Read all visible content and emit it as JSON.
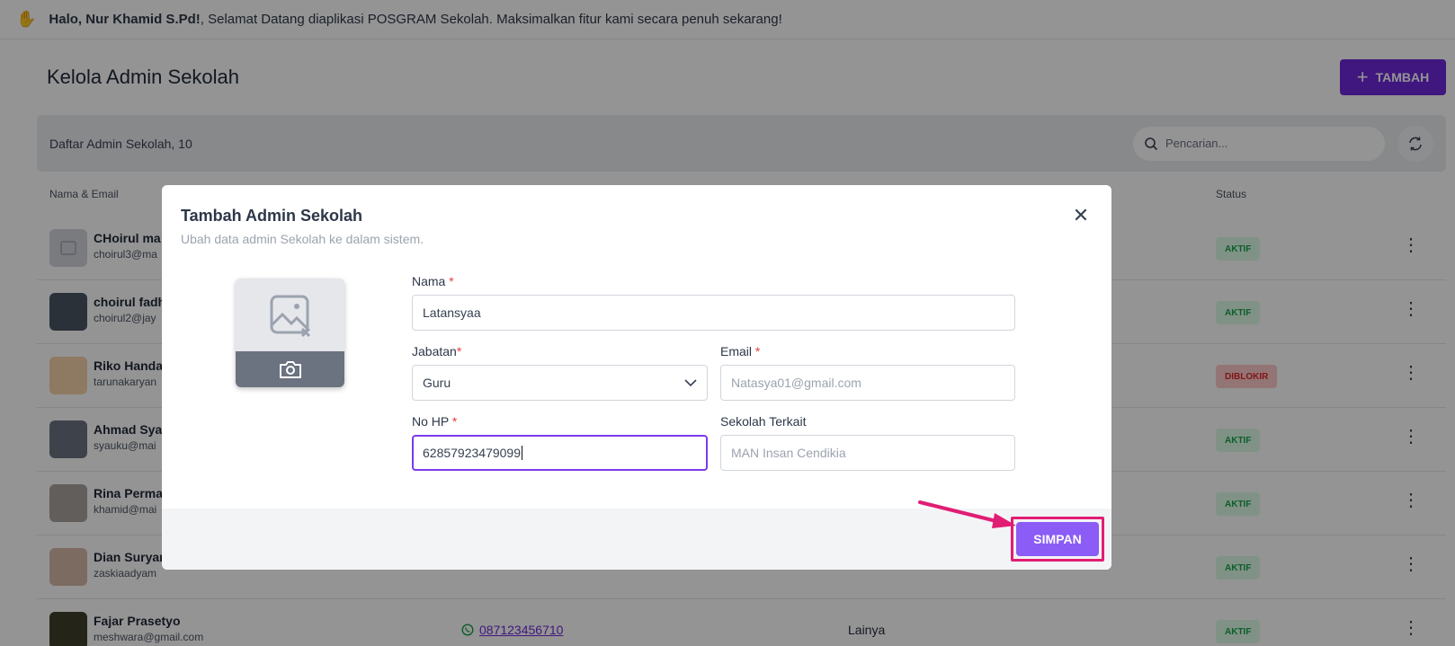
{
  "greeting": {
    "name": "Halo, Nur Khamid S.Pd!",
    "message": ", Selamat Datang diaplikasi POSGRAM Sekolah. Maksimalkan fitur kami secara penuh sekarang!"
  },
  "page": {
    "title": "Kelola Admin Sekolah",
    "add_label": "TAMBAH"
  },
  "list": {
    "title": "Daftar Admin Sekolah, 10",
    "search_placeholder": "Pencarian...",
    "columns": {
      "name_email": "Nama & Email",
      "status": "Status"
    },
    "rows": [
      {
        "name": "CHoirul ma",
        "email": "choirul3@ma",
        "status": "AKTIF"
      },
      {
        "name": "choirul fadh",
        "email": "choirul2@jay",
        "status": "AKTIF"
      },
      {
        "name": "Riko Handa",
        "email": "tarunakaryan",
        "status": "DIBLOKIR"
      },
      {
        "name": "Ahmad Sya",
        "email": "syauku@mai",
        "status": "AKTIF"
      },
      {
        "name": "Rina Perma",
        "email": "khamid@mai",
        "status": "AKTIF"
      },
      {
        "name": "Dian Suryan",
        "email": "zaskiaadyam",
        "status": "AKTIF"
      },
      {
        "name": "Fajar Prasetyo",
        "email": "meshwara@gmail.com",
        "phone": "087123456710",
        "role": "Lainya",
        "status": "AKTIF"
      }
    ]
  },
  "modal": {
    "title": "Tambah Admin Sekolah",
    "subtitle": "Ubah data admin Sekolah ke dalam sistem.",
    "fields": {
      "nama": {
        "label": "Nama",
        "value": "Latansyaa"
      },
      "jabatan": {
        "label": "Jabatan",
        "value": "Guru"
      },
      "email": {
        "label": "Email",
        "placeholder": "Natasya01@gmail.com"
      },
      "no_hp": {
        "label": "No HP",
        "value": "62857923479099"
      },
      "sekolah": {
        "label": "Sekolah Terkait",
        "placeholder": "MAN Insan Cendikia"
      }
    },
    "required_mark": "*",
    "save_label": "SIMPAN"
  },
  "colors": {
    "primary": "#6d28d9",
    "save_button": "#8b5cf6",
    "highlight": "#e11d74",
    "active_badge": "#16a34a",
    "blocked_badge": "#dc2626"
  },
  "icons": [
    "wave-hand-icon",
    "plus-icon",
    "search-icon",
    "refresh-icon",
    "kebab-icon",
    "whatsapp-icon",
    "close-icon",
    "image-placeholder-icon",
    "camera-icon",
    "chevron-down-icon",
    "arrow-annotation"
  ]
}
